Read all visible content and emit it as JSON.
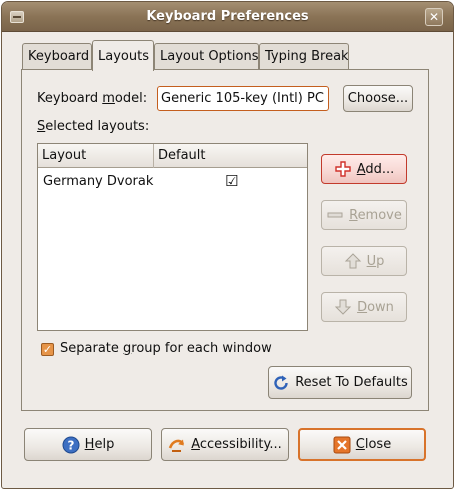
{
  "window": {
    "title": "Keyboard Preferences",
    "close_glyph": "✕"
  },
  "tabs": [
    {
      "label": "Keyboard",
      "active": false
    },
    {
      "label": "Layouts",
      "active": true
    },
    {
      "label": "Layout Options",
      "active": false
    },
    {
      "label": "Typing Break",
      "active": false
    }
  ],
  "layouts_tab": {
    "model_label_pre": "Keyboard ",
    "model_label_ul": "m",
    "model_label_post": "odel:",
    "model_value": "Generic 105-key (Intl) PC",
    "choose_label": "Choose...",
    "selected_ul": "S",
    "selected_post": "elected layouts:",
    "table": {
      "columns": [
        "Layout",
        "Default"
      ],
      "rows": [
        {
          "layout": "Germany Dvorak",
          "default": "☑"
        }
      ]
    },
    "buttons": {
      "add": {
        "ul": "A",
        "rest": "dd..."
      },
      "remove": {
        "ul": "R",
        "rest": "emove"
      },
      "up": {
        "ul": "U",
        "rest": "p"
      },
      "down": {
        "ul": "D",
        "rest": "own"
      }
    },
    "separate_check_glyph": "✓",
    "separate_pre": "Separate ",
    "separate_ul": "g",
    "separate_post": "roup for each window",
    "reset_label": "Reset To Defaults"
  },
  "footer": {
    "help": {
      "ul": "H",
      "rest": "elp"
    },
    "accessibility": {
      "ul": "A",
      "rest": "ccessibility..."
    },
    "close": {
      "ul": "C",
      "rest": "lose"
    }
  },
  "colors": {
    "titlebar": "#8a7356",
    "accent_orange": "#d8732b",
    "add_hover_red": "#c23a2c"
  }
}
